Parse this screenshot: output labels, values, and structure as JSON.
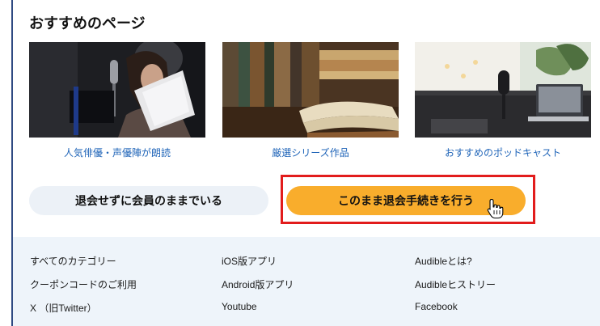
{
  "section": {
    "title": "おすすめのページ"
  },
  "cards": [
    {
      "caption": "人気俳優・声優陣が朗読"
    },
    {
      "caption": "厳選シリーズ作品"
    },
    {
      "caption": "おすすめのポッドキャスト"
    }
  ],
  "buttons": {
    "stay_label": "退会せずに会員のままでいる",
    "cancel_label": "このまま退会手続きを行う"
  },
  "footer": {
    "columns": [
      [
        "すべてのカテゴリー",
        "クーポンコードのご利用",
        "X （旧Twitter）"
      ],
      [
        "iOS版アプリ",
        "Android版アプリ",
        "Youtube"
      ],
      [
        "Audibleとは?",
        "Audibleヒストリー",
        "Facebook"
      ]
    ]
  },
  "colors": {
    "accent_button": "#f9ad2c",
    "secondary_button": "#ecf1f7",
    "link": "#1f64b8",
    "highlight": "#e21c1c",
    "footer_bg": "#eef4fa"
  }
}
